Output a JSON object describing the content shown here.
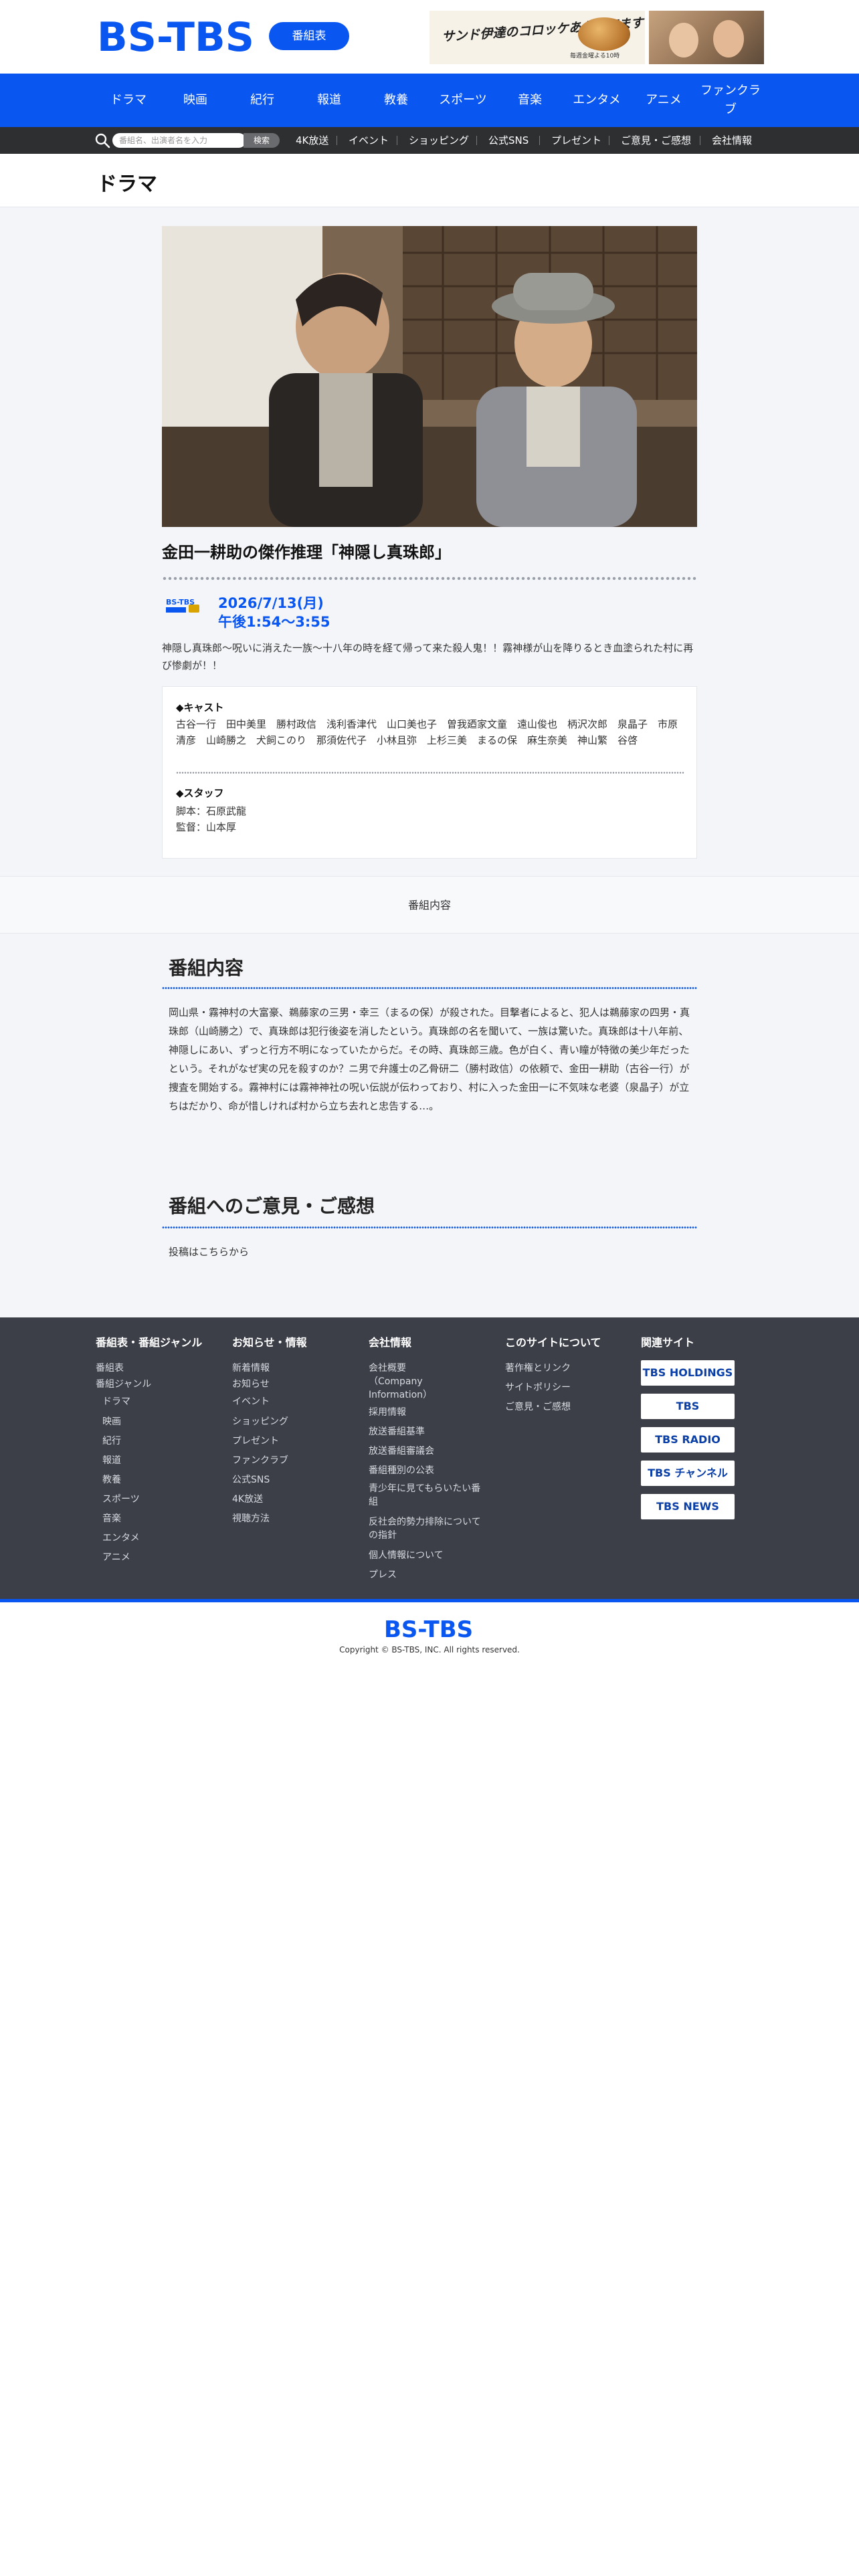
{
  "header": {
    "logo_text": "BS-TBS",
    "program_button": "番組表",
    "ad1_text": "サンド伊達のコロッケあがってます",
    "ad1_small": "毎週金曜よる10時"
  },
  "gnav": {
    "items": [
      "ドラマ",
      "映画",
      "紀行",
      "報道",
      "教養",
      "スポーツ",
      "音楽",
      "エンタメ",
      "アニメ",
      "ファンクラブ"
    ]
  },
  "subnav": {
    "search_placeholder": "番組名、出演者名を入力",
    "search_button": "検索",
    "items": [
      "4K放送",
      "イベント",
      "ショッピング",
      "公式SNS",
      "プレゼント",
      "ご意見・ご感想",
      "会社情報"
    ]
  },
  "page": {
    "title": "ドラマ"
  },
  "program": {
    "title": "金田一耕助の傑作推理「神隠し真珠郎」",
    "channel_mark": "BS-TBS",
    "date": "2026/7/13(月)",
    "time": "午後1:54〜3:55",
    "summary": "神隠し真珠郎〜呪いに消えた一族〜十八年の時を経て帰って来た殺人鬼！！霧神様が山を降りるとき血塗られた村に再び惨劇が！！",
    "cast_heading": "◆キャスト",
    "cast_text": "古谷一行　田中美里　勝村政信　浅利香津代　山口美也子　曽我廼家文童　遠山俊也　柄沢次郎　泉晶子　市原清彦　山崎勝之　犬飼このり　那須佐代子　小林且弥　上杉三美　まるの保　麻生奈美　神山繁　谷啓",
    "staff_heading": "◆スタッフ",
    "staff_lines": [
      "脚本：石原武龍",
      "監督：山本厚"
    ]
  },
  "tab": {
    "label": "番組内容"
  },
  "content_section": {
    "title": "番組内容",
    "body": "岡山県・霧神村の大富豪、鵜藤家の三男・幸三（まるの保）が殺された。目撃者によると、犯人は鵜藤家の四男・真珠郎（山崎勝之）で、真珠郎は犯行後姿を消したという。真珠郎の名を聞いて、一族は驚いた。真珠郎は十八年前、神隠しにあい、ずっと行方不明になっていたからだ。その時、真珠郎三歳。色が白く、青い瞳が特徴の美少年だったという。それがなぜ実の兄を殺すのか？ニ男で弁護士の乙骨研二（勝村政信）の依頼で、金田一耕助（古谷一行）が捜査を開始する。霧神村には霧神神社の呪い伝説が伝わっており、村に入った金田一に不気味な老婆（泉晶子）が立ちはだかり、命が惜しければ村から立ち去れと忠告する…。"
  },
  "feedback_section": {
    "title": "番組へのご意見・ご感想",
    "link": "投稿はこちらから"
  },
  "footer": {
    "col1": {
      "heading": "番組表・番組ジャンル",
      "links": [
        "番組表",
        "番組ジャンル",
        "ドラマ",
        "映画",
        "紀行",
        "報道",
        "教養",
        "スポーツ",
        "音楽",
        "エンタメ",
        "アニメ"
      ]
    },
    "col2": {
      "heading": "お知らせ・情報",
      "links": [
        "新着情報",
        "お知らせ",
        "イベント",
        "ショッピング",
        "プレゼント",
        "ファンクラブ",
        "公式SNS",
        "4K放送",
        "視聴方法"
      ]
    },
    "col3": {
      "heading": "会社情報",
      "links": [
        "会社概要",
        "（Company Information）",
        "採用情報",
        "放送番組基準",
        "放送番組審議会",
        "番組種別の公表",
        "青少年に見てもらいたい番組",
        "反社会的勢力排除についての指針",
        "個人情報について",
        "プレス"
      ]
    },
    "col4": {
      "heading": "このサイトについて",
      "links": [
        "著作権とリンク",
        "サイトポリシー",
        "ご意見・ご感想"
      ]
    },
    "col5": {
      "heading": "関連サイト",
      "badges": [
        "TBS HOLDINGS",
        "TBS",
        "TBS RADIO",
        "TBS チャンネル",
        "TBS NEWS"
      ]
    },
    "bottom_logo": "BS-TBS",
    "copyright": "Copyright © BS-TBS, INC. All rights reserved."
  },
  "colors": {
    "brand_blue": "#0a56f0",
    "footer_bg": "#3c3f48",
    "main_bg": "#f4f5f8"
  }
}
